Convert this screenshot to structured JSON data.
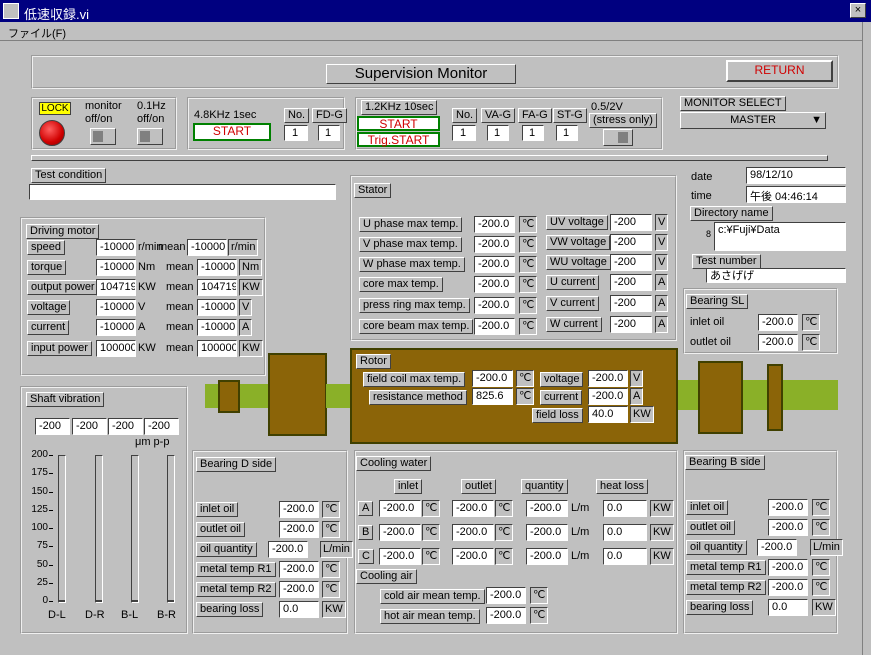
{
  "window": {
    "title": "低速収録.vi",
    "close_glyph": "×"
  },
  "menu": {
    "file": "ファイル(F)"
  },
  "header": {
    "title": "Supervision Monitor",
    "return_label": "RETURN"
  },
  "controls": {
    "lock_label": "LOCK",
    "monitor_label_1": "monitor",
    "monitor_label_2": "off/on",
    "hz_label_1": "0.1Hz",
    "hz_label_2": "off/on",
    "acq1": {
      "rate": "4.8KHz 1sec",
      "start": "START",
      "no_label": "No.",
      "no_value": "1",
      "fd_label": "FD-G",
      "fd_value": "1"
    },
    "acq2": {
      "rate": "1.2KHz 10sec",
      "start": "START",
      "trig": "Trig.START",
      "no_label": "No.",
      "no_value": "1",
      "va_label": "VA-G",
      "va_value": "1",
      "fa_label": "FA-G",
      "fa_value": "1",
      "st_label": "ST-G",
      "st_value": "1",
      "stress_1": "0.5/2V",
      "stress_2": "(stress only)"
    },
    "monitor_select": {
      "label": "MONITOR SELECT",
      "value": "MASTER"
    }
  },
  "test_condition": {
    "label": "Test condition",
    "value": ""
  },
  "info": {
    "date_label": "date",
    "date": "98/12/10",
    "time_label": "time",
    "time": "午後 04:46:14",
    "dir_label": "Directory name",
    "dir_prefix": "8",
    "dir": "c:¥Fuji¥Data",
    "test_label": "Test number",
    "test": "あさげげ"
  },
  "driving": {
    "title": "Driving motor",
    "mean": "mean",
    "rows": [
      {
        "label": "speed",
        "value": "-10000",
        "unit": "r/min",
        "mean": "-10000",
        "munit": "r/min"
      },
      {
        "label": "torque",
        "value": "-10000",
        "unit": "Nm",
        "mean": "-10000",
        "munit": "Nm"
      },
      {
        "label": "output power",
        "value": "104719",
        "unit": "KW",
        "mean": "104719",
        "munit": "KW"
      },
      {
        "label": "voltage",
        "value": "-10000",
        "unit": "V",
        "mean": "-10000",
        "munit": "V"
      },
      {
        "label": "current",
        "value": "-10000",
        "unit": "A",
        "mean": "-10000",
        "munit": "A"
      },
      {
        "label": "input power",
        "value": "100000",
        "unit": "KW",
        "mean": "100000",
        "munit": "KW"
      }
    ]
  },
  "stator": {
    "title": "Stator",
    "left": [
      {
        "label": "U phase max temp.",
        "value": "-200.0",
        "unit": "℃"
      },
      {
        "label": "V phase max temp.",
        "value": "-200.0",
        "unit": "℃"
      },
      {
        "label": "W phase max temp.",
        "value": "-200.0",
        "unit": "℃"
      },
      {
        "label": "core max temp.",
        "value": "-200.0",
        "unit": "℃"
      },
      {
        "label": "press ring max temp.",
        "value": "-200.0",
        "unit": "℃"
      },
      {
        "label": "core beam max temp.",
        "value": "-200.0",
        "unit": "℃"
      }
    ],
    "right": [
      {
        "label": "UV voltage",
        "value": "-200",
        "unit": "V"
      },
      {
        "label": "VW voltage",
        "value": "-200",
        "unit": "V"
      },
      {
        "label": "WU voltage",
        "value": "-200",
        "unit": "V"
      },
      {
        "label": "U current",
        "value": "-200",
        "unit": "A"
      },
      {
        "label": "V current",
        "value": "-200",
        "unit": "A"
      },
      {
        "label": "W current",
        "value": "-200",
        "unit": "A"
      }
    ]
  },
  "bearing_sl": {
    "title": "Bearing SL",
    "rows": [
      {
        "label": "inlet oil",
        "value": "-200.0",
        "unit": "℃"
      },
      {
        "label": "outlet oil",
        "value": "-200.0",
        "unit": "℃"
      }
    ]
  },
  "rotor": {
    "title": "Rotor",
    "field_coil": {
      "label": "field coil max temp.",
      "value": "-200.0",
      "unit": "℃"
    },
    "resistance": {
      "label": "resistance method",
      "value": "825.6",
      "unit": "℃"
    },
    "voltage": {
      "label": "voltage",
      "value": "-200.0",
      "unit": "V"
    },
    "current": {
      "label": "current",
      "value": "-200.0",
      "unit": "A"
    },
    "field_loss": {
      "label": "field loss",
      "value": "40.0",
      "unit": "KW"
    }
  },
  "shaft": {
    "title": "Shaft vibration",
    "values": [
      "-200",
      "-200",
      "-200",
      "-200"
    ],
    "unit": "μm p-p",
    "ticks": [
      "200",
      "175",
      "150",
      "125",
      "100",
      "75",
      "50",
      "25",
      "0"
    ],
    "bars": [
      {
        "label": "D-L",
        "level": 0
      },
      {
        "label": "D-R",
        "level": 0
      },
      {
        "label": "B-L",
        "level": 0
      },
      {
        "label": "B-R",
        "level": 0
      }
    ]
  },
  "bearing_d": {
    "title": "Bearing D side",
    "rows": [
      {
        "label": "inlet oil",
        "value": "-200.0",
        "unit": "℃"
      },
      {
        "label": "outlet oil",
        "value": "-200.0",
        "unit": "℃"
      },
      {
        "label": "oil quantity",
        "value": "-200.0",
        "unit": "L/min"
      },
      {
        "label": "metal temp R1",
        "value": "-200.0",
        "unit": "℃"
      },
      {
        "label": "metal temp R2",
        "value": "-200.0",
        "unit": "℃"
      },
      {
        "label": "bearing loss",
        "value": "0.0",
        "unit": "KW"
      }
    ]
  },
  "bearing_b": {
    "title": "Bearing B side",
    "rows": [
      {
        "label": "inlet oil",
        "value": "-200.0",
        "unit": "℃"
      },
      {
        "label": "outlet oil",
        "value": "-200.0",
        "unit": "℃"
      },
      {
        "label": "oil quantity",
        "value": "-200.0",
        "unit": "L/min"
      },
      {
        "label": "metal temp R1",
        "value": "-200.0",
        "unit": "℃"
      },
      {
        "label": "metal temp R2",
        "value": "-200.0",
        "unit": "℃"
      },
      {
        "label": "bearing loss",
        "value": "0.0",
        "unit": "KW"
      }
    ]
  },
  "cooling": {
    "title": "Cooling water",
    "headers": [
      "inlet",
      "outlet",
      "quantity",
      "heat loss"
    ],
    "rows": [
      {
        "label": "A",
        "inlet": "-200.0",
        "outlet": "-200.0",
        "quantity": "-200.0",
        "loss": "0.0"
      },
      {
        "label": "B",
        "inlet": "-200.0",
        "outlet": "-200.0",
        "quantity": "-200.0",
        "loss": "0.0"
      },
      {
        "label": "C",
        "inlet": "-200.0",
        "outlet": "-200.0",
        "quantity": "-200.0",
        "loss": "0.0"
      }
    ],
    "temp_unit": "℃",
    "qty_unit": "L/m",
    "loss_unit": "KW",
    "air_title": "Cooling air",
    "cold": {
      "label": "cold air mean temp.",
      "value": "-200.0",
      "unit": "℃"
    },
    "hot": {
      "label": "hot air mean temp.",
      "value": "-200.0",
      "unit": "℃"
    }
  }
}
